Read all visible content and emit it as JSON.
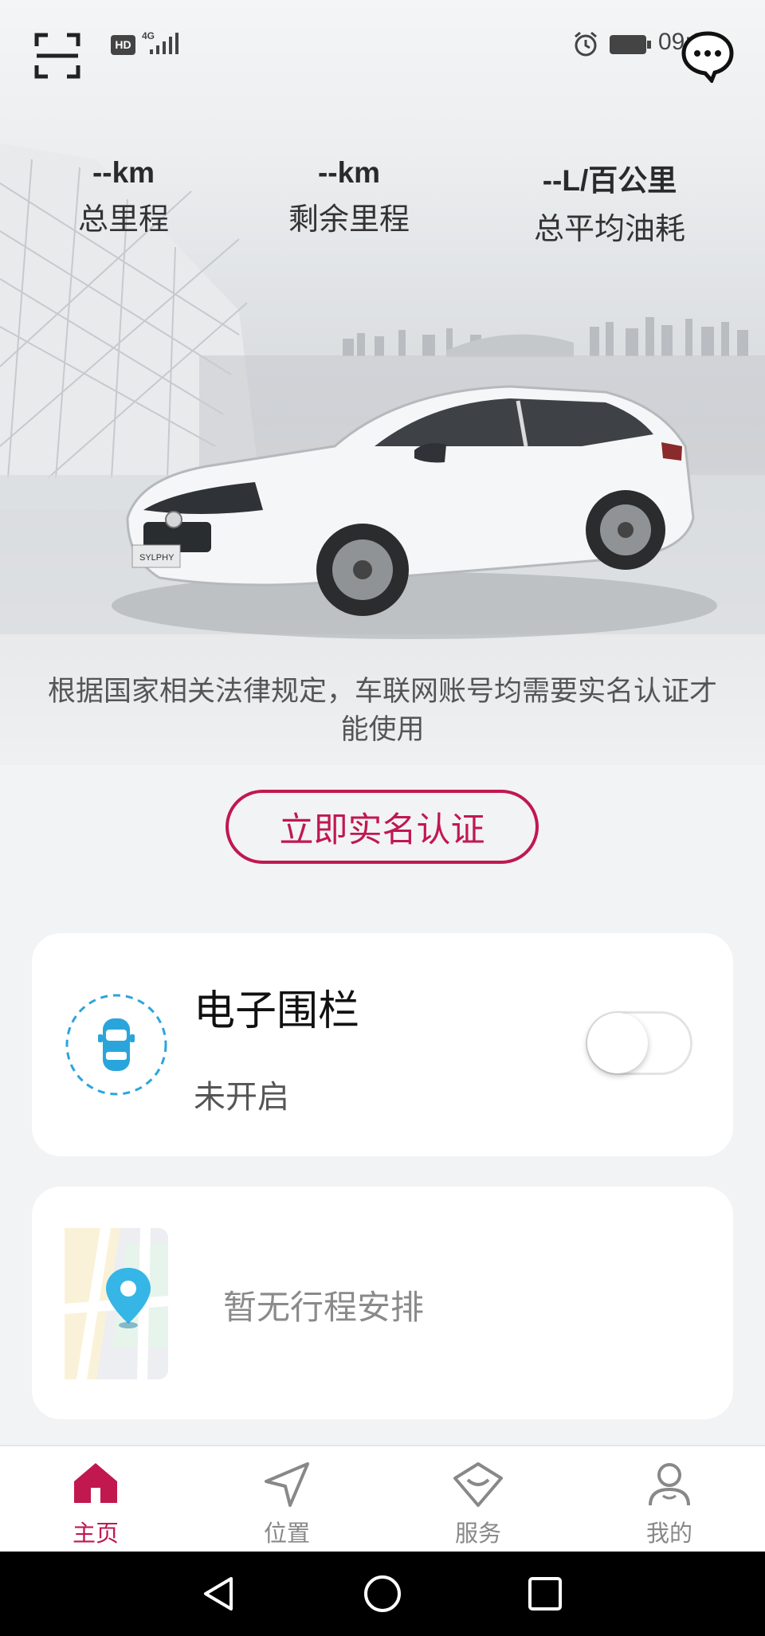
{
  "status_bar": {
    "hd_badge": "HD",
    "network": "4G",
    "time": "09:28",
    "icons": [
      "alarm-icon",
      "battery-icon",
      "signal-icon"
    ]
  },
  "header": {
    "scan_icon": "scan-icon",
    "message_icon": "message-icon"
  },
  "stats": [
    {
      "value": "--km",
      "label": "总里程"
    },
    {
      "value": "--km",
      "label": "剩余里程"
    },
    {
      "value": "--L/百公里",
      "label": "总平均油耗"
    }
  ],
  "car_badge": "SYLPHY",
  "notice": {
    "line1": "根据国家相关法律规定，车联网账号均需要实名认证才",
    "line2": "能使用"
  },
  "verify_button": "立即实名认证",
  "fence": {
    "title": "电子围栏",
    "status": "未开启",
    "enabled": false
  },
  "trip": {
    "empty_text": "暂无行程安排"
  },
  "tabs": [
    {
      "label": "主页",
      "icon": "home-icon",
      "active": true
    },
    {
      "label": "位置",
      "icon": "location-arrow-icon",
      "active": false
    },
    {
      "label": "服务",
      "icon": "service-icon",
      "active": false
    },
    {
      "label": "我的",
      "icon": "profile-icon",
      "active": false
    }
  ],
  "nav": [
    "back-icon",
    "home-circle-icon",
    "recents-icon"
  ],
  "colors": {
    "accent": "#c0184f",
    "fence_blue": "#2aa5dc",
    "background": "#f2f3f5"
  }
}
